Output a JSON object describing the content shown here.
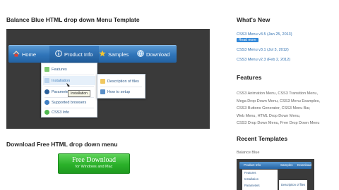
{
  "main": {
    "title": "Balance Blue HTML drop down Menu Template",
    "menu": {
      "items": [
        "Home",
        "Product Info",
        "Samples",
        "Download"
      ],
      "dropdown": [
        "Features",
        "Installation",
        "Parameters",
        "Supported browsers",
        "CSS3 Info"
      ],
      "submenu": [
        "Description of files",
        "How to setup"
      ],
      "tooltip": "Installation"
    },
    "download_heading": "Download Free HTML drop down menu",
    "download_button": {
      "main": "Free Download",
      "sub": "for Windows and Mac"
    }
  },
  "sidebar": {
    "whats_new": {
      "title": "What's New",
      "entries": [
        "CSS3 Menu v3.5 (Jan 25, 2013)",
        "CSS3 Menu v3.1 (Jul 3, 2012)",
        "CSS3 Menu v2.3 (Feb 2, 2012)"
      ],
      "read_more": "Read more"
    },
    "features": {
      "title": "Features",
      "tags": [
        "CSS3 Animation Menu",
        "CSS3 Transition Menu",
        "Mega Drop Down Menu",
        "CSS3 Menu Examples",
        "CSS3 Buttons Generator",
        "CSS3 Menu Bar",
        "Web Menu",
        "HTML Drop Down Menu",
        "CSS3 Drop Down Menu",
        "Free Drop Down Menu"
      ]
    },
    "recent": {
      "title": "Recent Templates",
      "item_label": "Balance Blue",
      "thumb_menu": [
        "Product Info",
        "Samples",
        "Download"
      ],
      "thumb_dropdown": [
        "Features",
        "Installation",
        "Parameters"
      ],
      "thumb_submenu": "Description of files"
    }
  },
  "colors": {
    "menu_blue": "#2f74b8",
    "link_blue": "#2e6fb0",
    "download_green": "#2bb12a",
    "preview_bg": "#3a3a3a"
  }
}
